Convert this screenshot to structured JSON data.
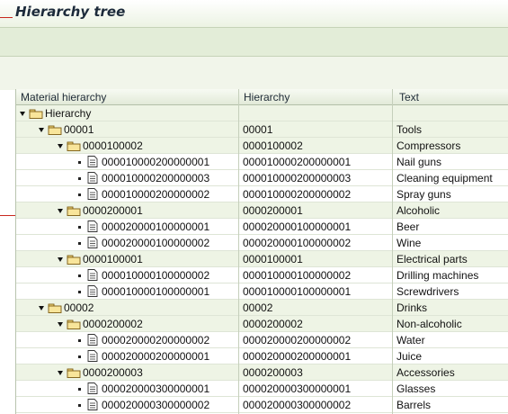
{
  "header": {
    "title": "Hierarchy tree"
  },
  "toolbar": {
    "buttons": [
      {
        "name": "expand-subtree-button",
        "icon": "expand-icon"
      },
      {
        "name": "collapse-subtree-button",
        "icon": "collapse-icon"
      },
      {
        "name": "find-button",
        "icon": "binoculars-icon"
      },
      {
        "name": "total-button",
        "icon": "sum-icon"
      },
      {
        "name": "print-button",
        "icon": "printer-icon"
      },
      {
        "name": "layout-button",
        "icon": "table-icon"
      }
    ]
  },
  "columns": [
    "Material hierarchy",
    "Hierarchy",
    "Text"
  ],
  "rows": [
    {
      "type": "root",
      "label": "Hierarchy",
      "hier": "",
      "text": ""
    },
    {
      "type": "node",
      "label": "00001",
      "hier": "00001",
      "text": "Tools"
    },
    {
      "type": "node",
      "label": "0000100002",
      "hier": "0000100002",
      "text": "Compressors"
    },
    {
      "type": "leaf",
      "label": "000010000200000001",
      "hier": "000010000200000001",
      "text": "Nail guns"
    },
    {
      "type": "leaf",
      "label": "000010000200000003",
      "hier": "000010000200000003",
      "text": "Cleaning equipment"
    },
    {
      "type": "leaf",
      "label": "000010000200000002",
      "hier": "000010000200000002",
      "text": "Spray guns"
    },
    {
      "type": "node",
      "label": "0000200001",
      "hier": "0000200001",
      "text": "Alcoholic"
    },
    {
      "type": "leaf",
      "label": "000020000100000001",
      "hier": "000020000100000001",
      "text": "Beer"
    },
    {
      "type": "leaf",
      "label": "000020000100000002",
      "hier": "000020000100000002",
      "text": "Wine"
    },
    {
      "type": "node",
      "label": "0000100001",
      "hier": "0000100001",
      "text": "Electrical parts"
    },
    {
      "type": "leaf",
      "label": "000010000100000002",
      "hier": "000010000100000002",
      "text": "Drilling machines"
    },
    {
      "type": "leaf",
      "label": "000010000100000001",
      "hier": "000010000100000001",
      "text": "Screwdrivers"
    },
    {
      "type": "node",
      "label": "00002",
      "hier": "00002",
      "text": "Drinks"
    },
    {
      "type": "node",
      "label": "0000200002",
      "hier": "0000200002",
      "text": "Non-alcoholic"
    },
    {
      "type": "leaf",
      "label": "000020000200000002",
      "hier": "000020000200000002",
      "text": "Water"
    },
    {
      "type": "leaf",
      "label": "000020000200000001",
      "hier": "000020000200000001",
      "text": "Juice"
    },
    {
      "type": "node",
      "label": "0000200003",
      "hier": "0000200003",
      "text": "Accessories"
    },
    {
      "type": "leaf",
      "label": "000020000300000001",
      "hier": "000020000300000001",
      "text": "Glasses"
    },
    {
      "type": "leaf",
      "label": "000020000300000002",
      "hier": "000020000300000002",
      "text": "Barrels"
    }
  ]
}
